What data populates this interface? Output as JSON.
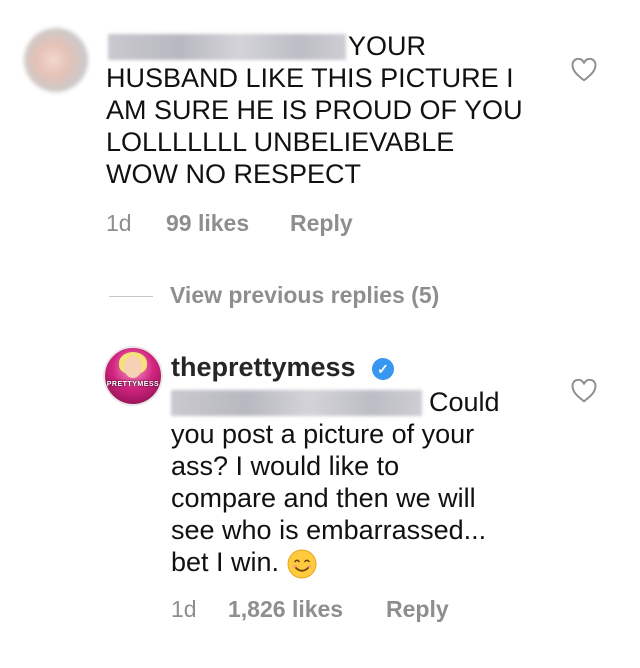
{
  "comments": [
    {
      "text": "YOUR\nHUSBAND LIKE THIS PICTURE I\nAM SURE HE IS PROUD OF YOU\nLOLLLLLLL UNBELIEVABLE\nWOW NO RESPECT",
      "age": "1d",
      "likes": "99 likes",
      "reply": "Reply"
    }
  ],
  "view_previous": "View previous replies (5)",
  "reply": {
    "username": "theprettymess",
    "avatar_text": "PRETTYMESS",
    "text": "Could\nyou post a picture of your\nass? I would like to\ncompare and then we will\nsee who is embarrassed...\nbet I win.",
    "age": "1d",
    "likes": "1,826 likes",
    "reply": "Reply"
  },
  "icons": [
    "heart-icon",
    "verified-badge-icon",
    "smiling-face-emoji"
  ],
  "colors": {
    "verified": "#3897f0",
    "meta_text": "#8e8e8e",
    "text": "#111111"
  }
}
